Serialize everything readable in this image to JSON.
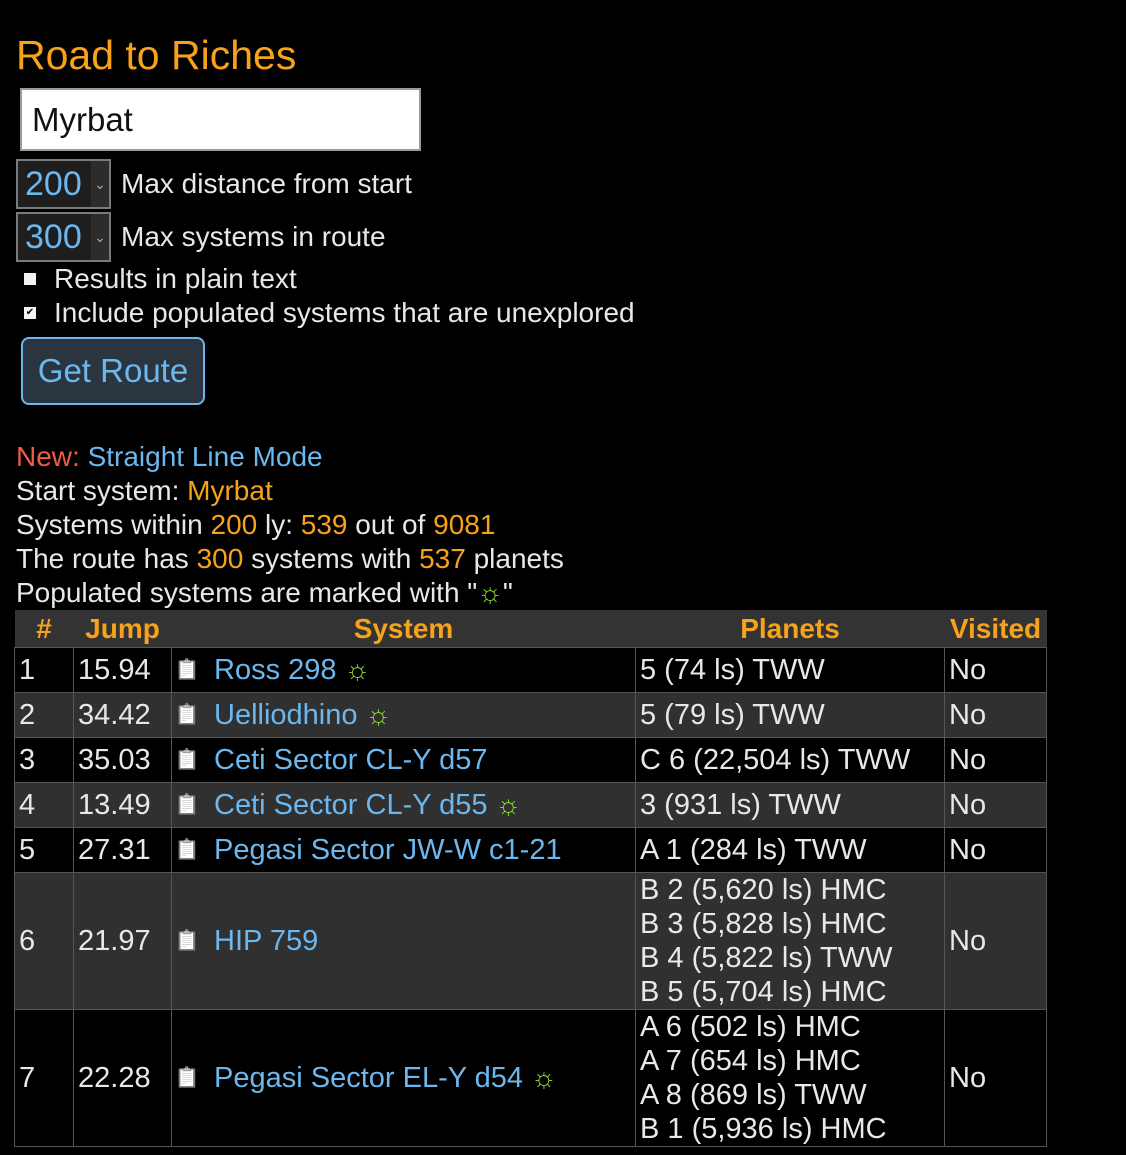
{
  "title": "Road to Riches",
  "start_input": {
    "value": "Myrbat",
    "placeholder": ""
  },
  "max_distance": {
    "value": "200",
    "label": "Max distance from start"
  },
  "max_systems": {
    "value": "300",
    "label": "Max systems in route"
  },
  "options": {
    "plain_text": {
      "label": "Results in plain text",
      "checked": false
    },
    "include_unexplored": {
      "label": "Include populated systems that are unexplored",
      "checked": true
    }
  },
  "get_route_label": "Get Route",
  "info": {
    "new_prefix": "New:",
    "new_link": "Straight Line Mode",
    "start_label": "Start system:",
    "start_value": "Myrbat",
    "within_prefix": "Systems within",
    "within_distance": "200",
    "within_unit": "ly:",
    "within_count": "539",
    "within_outof": "out of",
    "within_total": "9081",
    "route_prefix": "The route has",
    "route_systems": "300",
    "route_mid": "systems with",
    "route_planets": "537",
    "route_suffix": "planets",
    "populated_text": "Populated systems are marked with \"",
    "populated_close": "\""
  },
  "table": {
    "headers": {
      "num": "#",
      "jump": "Jump",
      "system": "System",
      "planets": "Planets",
      "visited": "Visited"
    },
    "rows": [
      {
        "num": "1",
        "jump": "15.94",
        "system": "Ross 298",
        "populated": true,
        "planets": [
          "5 (74 ls) TWW"
        ],
        "visited": "No"
      },
      {
        "num": "2",
        "jump": "34.42",
        "system": "Uelliodhino",
        "populated": true,
        "planets": [
          "5 (79 ls) TWW"
        ],
        "visited": "No"
      },
      {
        "num": "3",
        "jump": "35.03",
        "system": "Ceti Sector CL-Y d57",
        "populated": false,
        "planets": [
          "C 6 (22,504 ls) TWW"
        ],
        "visited": "No"
      },
      {
        "num": "4",
        "jump": "13.49",
        "system": "Ceti Sector CL-Y d55",
        "populated": true,
        "planets": [
          "3 (931 ls) TWW"
        ],
        "visited": "No"
      },
      {
        "num": "5",
        "jump": "27.31",
        "system": "Pegasi Sector JW-W c1-21",
        "populated": false,
        "planets": [
          "A 1 (284 ls) TWW"
        ],
        "visited": "No"
      },
      {
        "num": "6",
        "jump": "21.97",
        "system": "HIP 759",
        "populated": false,
        "planets": [
          "B 2 (5,620 ls) HMC",
          "B 3 (5,828 ls) HMC",
          "B 4 (5,822 ls) TWW",
          "B 5 (5,704 ls) HMC"
        ],
        "visited": "No"
      },
      {
        "num": "7",
        "jump": "22.28",
        "system": "Pegasi Sector EL-Y d54",
        "populated": true,
        "planets": [
          "A 6 (502 ls) HMC",
          "A 7 (654 ls) HMC",
          "A 8 (869 ls) TWW",
          "B 1 (5,936 ls) HMC"
        ],
        "visited": "No"
      }
    ]
  },
  "icons": {
    "clipboard": "clipboard-icon",
    "populated": "sun-icon"
  },
  "colors": {
    "accent": "#f7a21b",
    "link": "#6bb7ee",
    "new": "#ef5a4a",
    "populated": "#8de02a",
    "header_bg": "#333333",
    "row_alt_bg": "#303030"
  }
}
